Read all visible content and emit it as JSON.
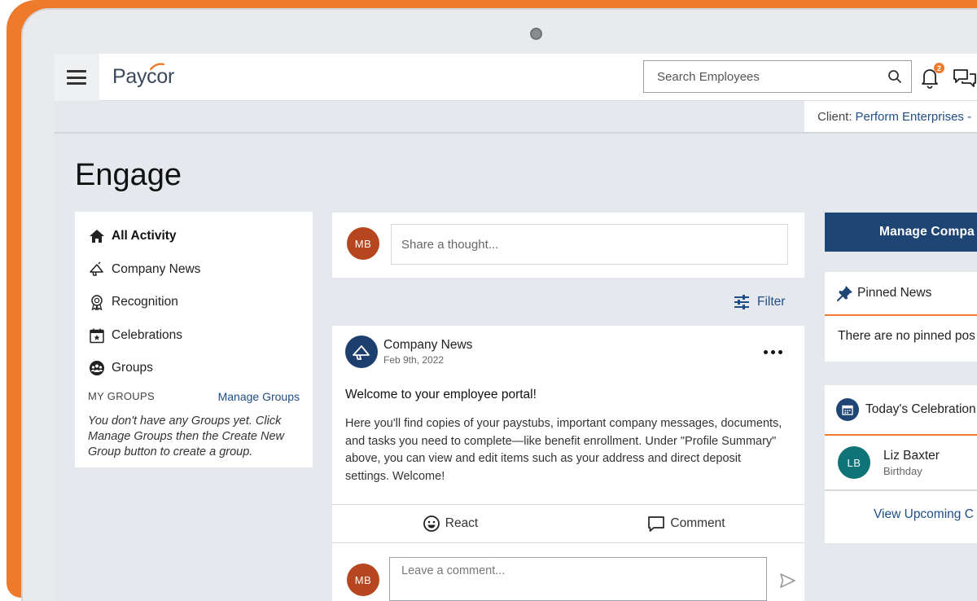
{
  "header": {
    "logo": "Paycor",
    "search_placeholder": "Search Employees",
    "notification_count": "2"
  },
  "subbar": {
    "client_label": "Client:",
    "client_name": "Perform Enterprises -"
  },
  "page": {
    "title": "Engage"
  },
  "leftnav": {
    "items": [
      {
        "label": "All Activity"
      },
      {
        "label": "Company News"
      },
      {
        "label": "Recognition"
      },
      {
        "label": "Celebrations"
      },
      {
        "label": "Groups"
      }
    ],
    "my_groups_label": "MY GROUPS",
    "manage_groups_label": "Manage Groups",
    "no_groups_text": "You don't have any Groups yet. Click Manage Groups then the Create New Group button to create a group."
  },
  "feed": {
    "user_initials": "MB",
    "share_placeholder": "Share a thought...",
    "filter_label": "Filter",
    "post": {
      "author": "Company News",
      "date": "Feb 9th, 2022",
      "title": "Welcome to your employee portal!",
      "body": "Here you'll find copies of your paystubs, important company messages, documents, and tasks you need to complete—like benefit enrollment. Under \"Profile Summary\" above, you can view and edit items such as your address and direct deposit settings. Welcome!",
      "react_label": "React",
      "comment_label": "Comment",
      "comment_placeholder": "Leave a comment..."
    }
  },
  "rightcol": {
    "manage_button_label": "Manage Compa",
    "pinned": {
      "title": "Pinned News",
      "empty_text": "There are no pinned pos"
    },
    "celebrations": {
      "title": "Today's Celebration",
      "person_initials": "LB",
      "person_name": "Liz Baxter",
      "person_event": "Birthday",
      "view_upcoming_label": "View Upcoming C"
    }
  },
  "colors": {
    "brand_orange": "#ee7a2c",
    "navy": "#1e4573",
    "link_blue": "#1f4e86",
    "avatar_mb": "#b6461f",
    "avatar_lb": "#0f7378"
  }
}
